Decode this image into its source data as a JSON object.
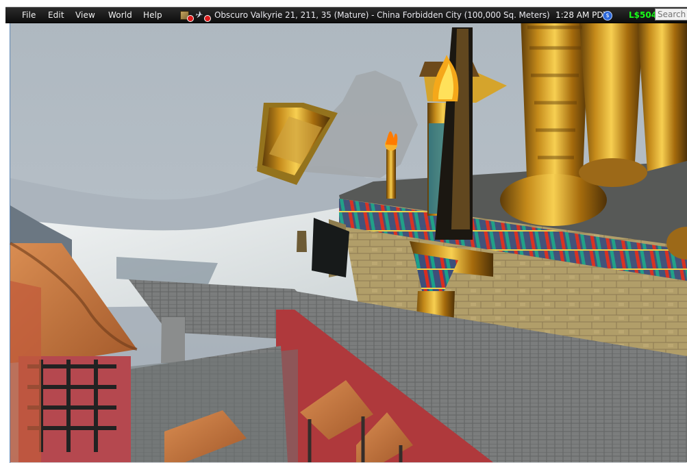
{
  "menu": [
    "File",
    "Edit",
    "View",
    "World",
    "Help"
  ],
  "location": "Obscuro Valkyrie 21, 211, 35 (Mature) - China Forbidden City (100,000 Sq. Meters)",
  "clock": "1:28 AM PDT",
  "balance": "L$504",
  "search": {
    "placeholder": "Search"
  },
  "colors": {
    "menu_bg": "#111111",
    "money_green": "#18ff18",
    "frame_border": "#5f87b5"
  },
  "icons": [
    "inventory-icon",
    "fly-icon",
    "money-icon"
  ]
}
